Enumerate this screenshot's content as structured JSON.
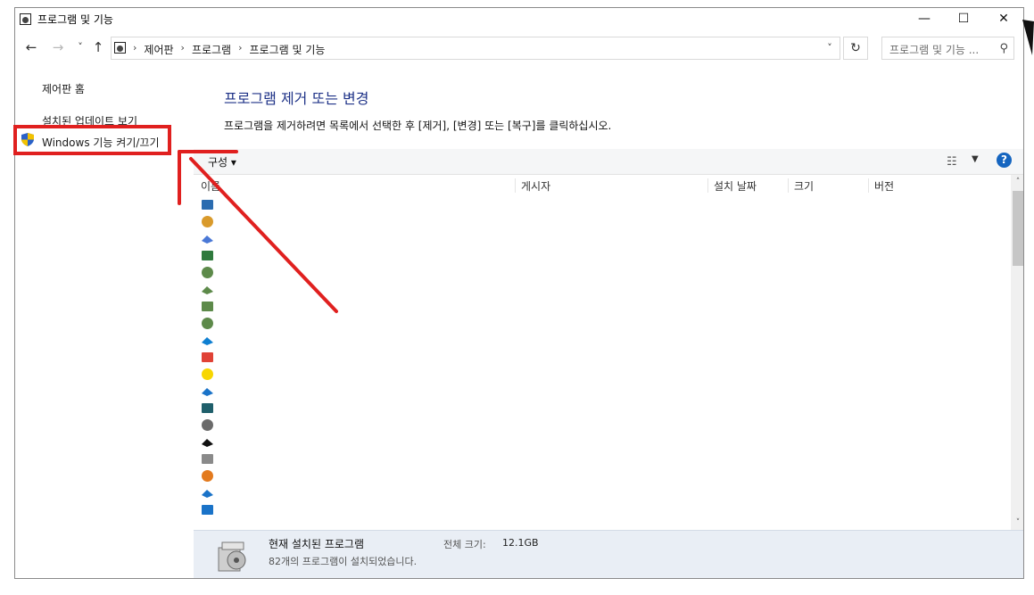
{
  "window": {
    "title": "프로그램 및 기능",
    "minimize_icon": "—",
    "maximize_icon": "☐",
    "close_icon": "✕"
  },
  "nav": {
    "back": "←",
    "forward": "→",
    "recent": "˅",
    "up": "↑",
    "breadcrumbs": [
      "제어판",
      "프로그램",
      "프로그램 및 기능"
    ],
    "separator": "›",
    "dropdown": "˅",
    "refresh": "↻",
    "search_placeholder": "프로그램 및 기능 ...",
    "search_icon": "⚲"
  },
  "left_pane": {
    "home_link": "제어판 홈",
    "updates_link": "설치된 업데이트 보기",
    "features_link": "Windows 기능 켜기/끄기"
  },
  "main": {
    "heading": "프로그램 제거 또는 변경",
    "description": "프로그램을 제거하려면 목록에서 선택한 후 [제거], [변경] 또는 [복구]를 클릭하십시오.",
    "organize_label": "구성 ▾",
    "view_icon": "☷",
    "view_dropdown": "▼",
    "help_label": "?",
    "columns": [
      "이름",
      "게시자",
      "설치 날짜",
      "크기",
      "버전"
    ],
    "program_icons": [
      {
        "name": "window-app-icon",
        "color": "#2b6cb0"
      },
      {
        "name": "package-icon",
        "color": "#d99a2b"
      },
      {
        "name": "samsung-app-icon",
        "color": "#4a78d6"
      },
      {
        "name": "installer-icon",
        "color": "#2f7a3d"
      },
      {
        "name": "network-adapter-icon",
        "color": "#5d8a4a"
      },
      {
        "name": "network-adapter-icon",
        "color": "#5d8a4a"
      },
      {
        "name": "network-adapter-icon",
        "color": "#5d8a4a"
      },
      {
        "name": "network-adapter-icon",
        "color": "#5d8a4a"
      },
      {
        "name": "edge-icon",
        "color": "#0f7fd1"
      },
      {
        "name": "chrome-icon",
        "color": "#e04236"
      },
      {
        "name": "kakaotalk-icon",
        "color": "#f7d600"
      },
      {
        "name": "onedrive-icon",
        "color": "#1a73c8"
      },
      {
        "name": "game-app-icon",
        "color": "#1f5f6b"
      },
      {
        "name": "window-app-icon",
        "color": "#6b6b6b"
      },
      {
        "name": "g-app-icon",
        "color": "#111111"
      },
      {
        "name": "disk-app-icon",
        "color": "#8a8a8a"
      },
      {
        "name": "shield-app-icon",
        "color": "#e37a1e"
      },
      {
        "name": "bolt-app-icon",
        "color": "#1a73c8"
      },
      {
        "name": "health-app-icon",
        "color": "#1a73c8"
      }
    ],
    "scroll_up": "˄",
    "scroll_down": "˅"
  },
  "status": {
    "title": "현재 설치된 프로그램",
    "size_label": "전체 크기:",
    "size_value": "12.1GB",
    "count_text": "82개의 프로그램이 설치되었습니다."
  },
  "colors": {
    "heading": "#1e3287",
    "annotation": "#e0201f",
    "status_bg": "#e9eef5"
  }
}
